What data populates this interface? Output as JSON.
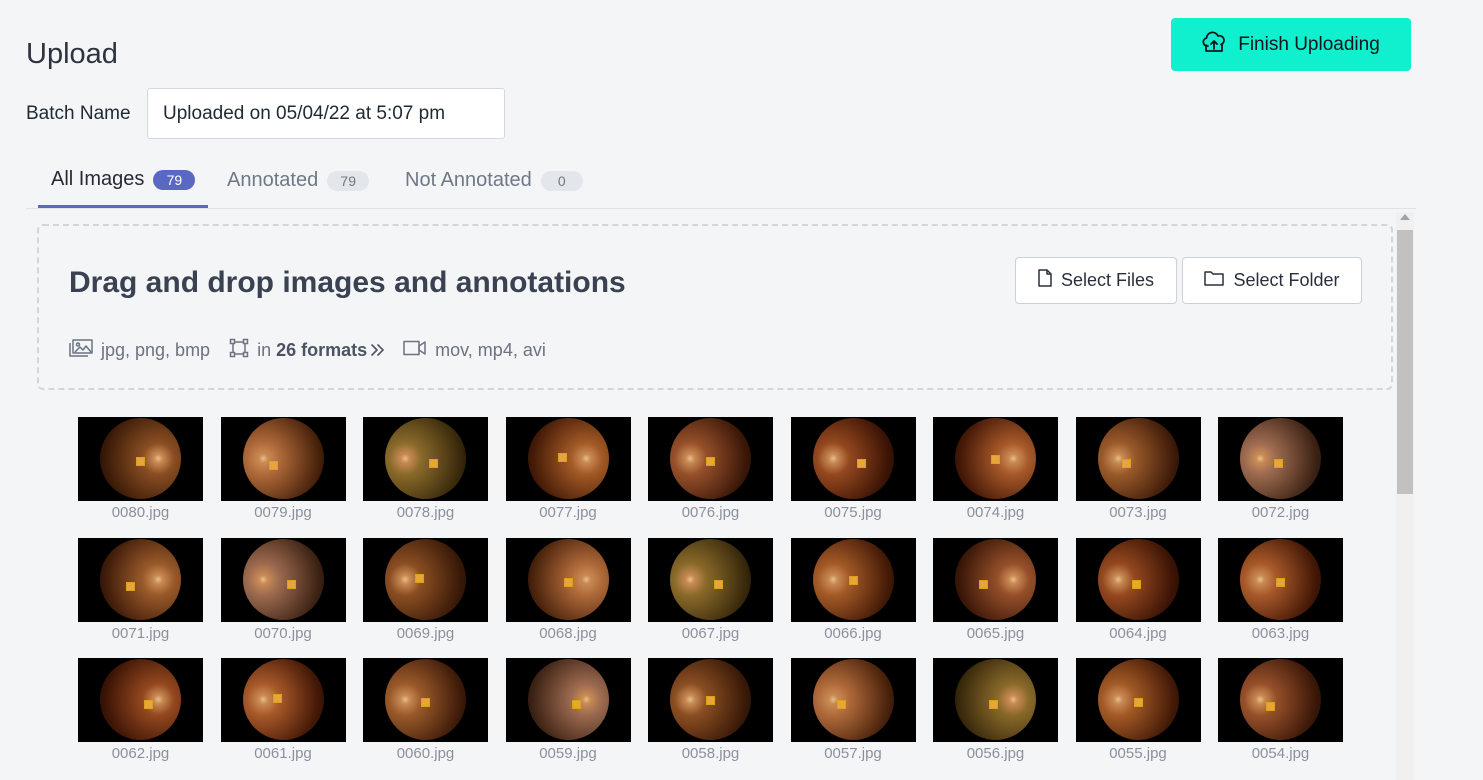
{
  "page": {
    "title": "Upload"
  },
  "header": {
    "finish_label": "Finish Uploading",
    "finish_icon": "cloud-upload-icon",
    "accent": "#10f0cf"
  },
  "batch": {
    "label": "Batch Name",
    "value": "Uploaded on 05/04/22 at 5:07 pm"
  },
  "tabs": [
    {
      "label": "All Images",
      "count": "79",
      "active": true
    },
    {
      "label": "Annotated",
      "count": "79",
      "active": false
    },
    {
      "label": "Not Annotated",
      "count": "0",
      "active": false
    }
  ],
  "dropzone": {
    "title": "Drag and drop images and annotations",
    "select_files": "Select Files",
    "select_folder": "Select Folder",
    "image_formats": "jpg, png, bmp",
    "annotation_prefix": "in",
    "annotation_formats": "26 formats",
    "video_formats": "mov, mp4, avi"
  },
  "images": [
    "0080.jpg",
    "0079.jpg",
    "0078.jpg",
    "0077.jpg",
    "0076.jpg",
    "0075.jpg",
    "0074.jpg",
    "0073.jpg",
    "0072.jpg",
    "0071.jpg",
    "0070.jpg",
    "0069.jpg",
    "0068.jpg",
    "0067.jpg",
    "0066.jpg",
    "0065.jpg",
    "0064.jpg",
    "0063.jpg",
    "0062.jpg",
    "0061.jpg",
    "0060.jpg",
    "0059.jpg",
    "0058.jpg",
    "0057.jpg",
    "0056.jpg",
    "0055.jpg",
    "0054.jpg"
  ]
}
